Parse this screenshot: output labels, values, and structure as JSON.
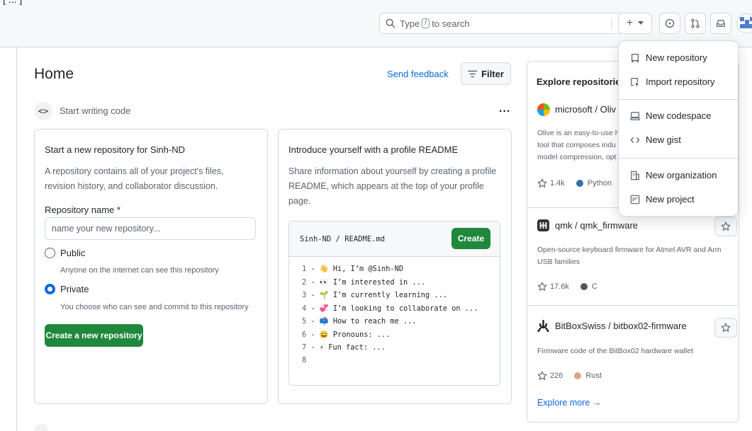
{
  "header": {
    "search_placeholder_pre": "Type",
    "search_key": "/",
    "search_placeholder_post": "to search",
    "create_label": "+"
  },
  "main": {
    "title": "Home",
    "send_feedback": "Send feedback",
    "filter_label": "Filter",
    "start_writing": "Start writing code",
    "more": "..."
  },
  "new_repo_card": {
    "title": "Start a new repository for Sinh-ND",
    "description_line1": "A repository contains all of your project's files,",
    "description_line2": "revision history, and collaborator discussion.",
    "name_label": "Repository name *",
    "name_placeholder": "name your new repository...",
    "public_label": "Public",
    "public_desc": "Anyone on the internet can see this repository",
    "private_label": "Private",
    "private_desc": "You choose who can see and commit to this repository",
    "selected_visibility": "Private",
    "create_button": "Create a new repository"
  },
  "readme_card": {
    "title": "Introduce yourself with a profile README",
    "description_line1": "Share information about yourself by creating a profile",
    "description_line2": "README, which appears at the top of your profile",
    "description_line3": "page.",
    "path": "Sinh-ND / README.md",
    "create_button": "Create",
    "lines": [
      {
        "num": "1",
        "text": "- 👋 Hi, I’m @Sinh-ND"
      },
      {
        "num": "2",
        "text": "- 👀 I’m interested in ..."
      },
      {
        "num": "3",
        "text": "- 🌱 I’m currently learning ..."
      },
      {
        "num": "4",
        "text": "- 💞️ I’m looking to collaborate on ..."
      },
      {
        "num": "5",
        "text": "- 📫 How to reach me ..."
      },
      {
        "num": "6",
        "text": "- 😄 Pronouns: ..."
      },
      {
        "num": "7",
        "text": "- ⚡ Fun fact: ..."
      },
      {
        "num": "8",
        "text": ""
      }
    ]
  },
  "explore": {
    "title": "Explore repositories",
    "repos": [
      {
        "owner": "microsoft",
        "sep": " / ",
        "name": "Oliv",
        "desc_line1": "Olive is an easy-to-use h",
        "desc_line2": "tool that composes indu",
        "desc_line3": "model compression, opt",
        "stars": "1.4k",
        "language": "Python",
        "lang_color": "#3572A5"
      },
      {
        "owner": "qmk",
        "sep": " / ",
        "name": "qmk_firmware",
        "desc_line1": "Open-source keyboard firmware for Atmel AVR and Arm",
        "desc_line2": "USB families",
        "stars": "17.6k",
        "language": "C",
        "lang_color": "#555555"
      },
      {
        "owner": "BitBoxSwiss",
        "sep": " / ",
        "name": "bitbox02-firmware",
        "desc_line1": "Firmware code of the BitBox02 hardware wallet",
        "stars": "226",
        "language": "Rust",
        "lang_color": "#dea584"
      }
    ],
    "explore_more": "Explore more →"
  },
  "create_menu": {
    "items": [
      {
        "label": "New repository",
        "icon": "repo-icon"
      },
      {
        "label": "Import repository",
        "icon": "repo-push-icon"
      },
      {
        "label": "New codespace",
        "icon": "codespace-icon"
      },
      {
        "label": "New gist",
        "icon": "code-icon"
      },
      {
        "label": "New organization",
        "icon": "organization-icon"
      },
      {
        "label": "New project",
        "icon": "project-icon"
      }
    ]
  },
  "colors": {
    "accent": "#0969da",
    "primary_button": "#1f883d",
    "border": "#d1d9e0",
    "muted_text": "#59636e"
  }
}
